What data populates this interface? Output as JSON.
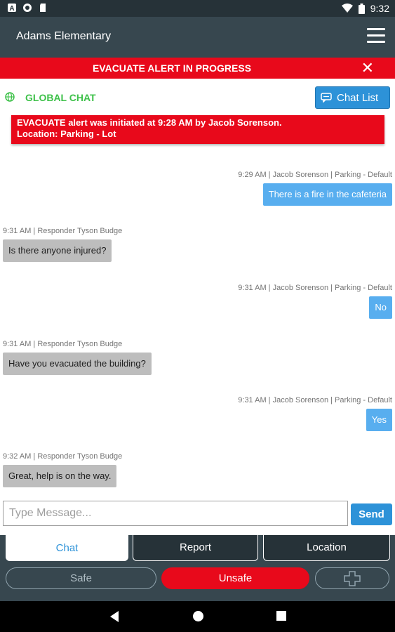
{
  "status_bar": {
    "time": "9:32",
    "left_icons": [
      "notification-a-icon",
      "sync-icon",
      "sd-card-icon"
    ],
    "right_icons": [
      "wifi-icon",
      "battery-icon"
    ]
  },
  "app_bar": {
    "title": "Adams Elementary",
    "menu_icon": "hamburger-menu-icon"
  },
  "alert_banner": {
    "text": "EVACUATE ALERT IN PROGRESS",
    "close_icon": "close-icon"
  },
  "chat_header": {
    "label": "GLOBAL CHAT",
    "chat_list_button": "Chat List"
  },
  "system_message": {
    "line1": "EVACUATE alert was initiated at 9:28 AM by Jacob Sorenson.",
    "line2": "Location: Parking - Lot"
  },
  "messages": [
    {
      "direction": "out",
      "meta": "9:29 AM |  Jacob Sorenson | Parking - Default",
      "text": "There is a fire in the cafeteria"
    },
    {
      "direction": "in",
      "meta": "9:31 AM | Responder Tyson Budge",
      "text": "Is there anyone injured?"
    },
    {
      "direction": "out",
      "meta": "9:31 AM |  Jacob Sorenson | Parking - Default",
      "text": "No"
    },
    {
      "direction": "in",
      "meta": "9:31 AM | Responder Tyson Budge",
      "text": "Have you evacuated the building?"
    },
    {
      "direction": "out",
      "meta": "9:31 AM |  Jacob Sorenson | Parking - Default",
      "text": "Yes"
    },
    {
      "direction": "in",
      "meta": "9:32 AM | Responder Tyson Budge",
      "text": "Great, help is on the way."
    }
  ],
  "composer": {
    "placeholder": "Type Message...",
    "value": "",
    "send_label": "Send"
  },
  "tabs": [
    {
      "label": "Chat",
      "active": true
    },
    {
      "label": "Report",
      "active": false
    },
    {
      "label": "Location",
      "active": false
    }
  ],
  "status_buttons": {
    "safe": "Safe",
    "unsafe": "Unsafe",
    "medical_icon": "medical-cross-icon"
  },
  "colors": {
    "alert_red": "#e8091b",
    "app_bar": "#37474f",
    "accent_blue": "#2d92d8",
    "outgoing_bubble": "#58aeef",
    "incoming_bubble": "#bdbdbd",
    "global_green": "#3ec14a"
  }
}
